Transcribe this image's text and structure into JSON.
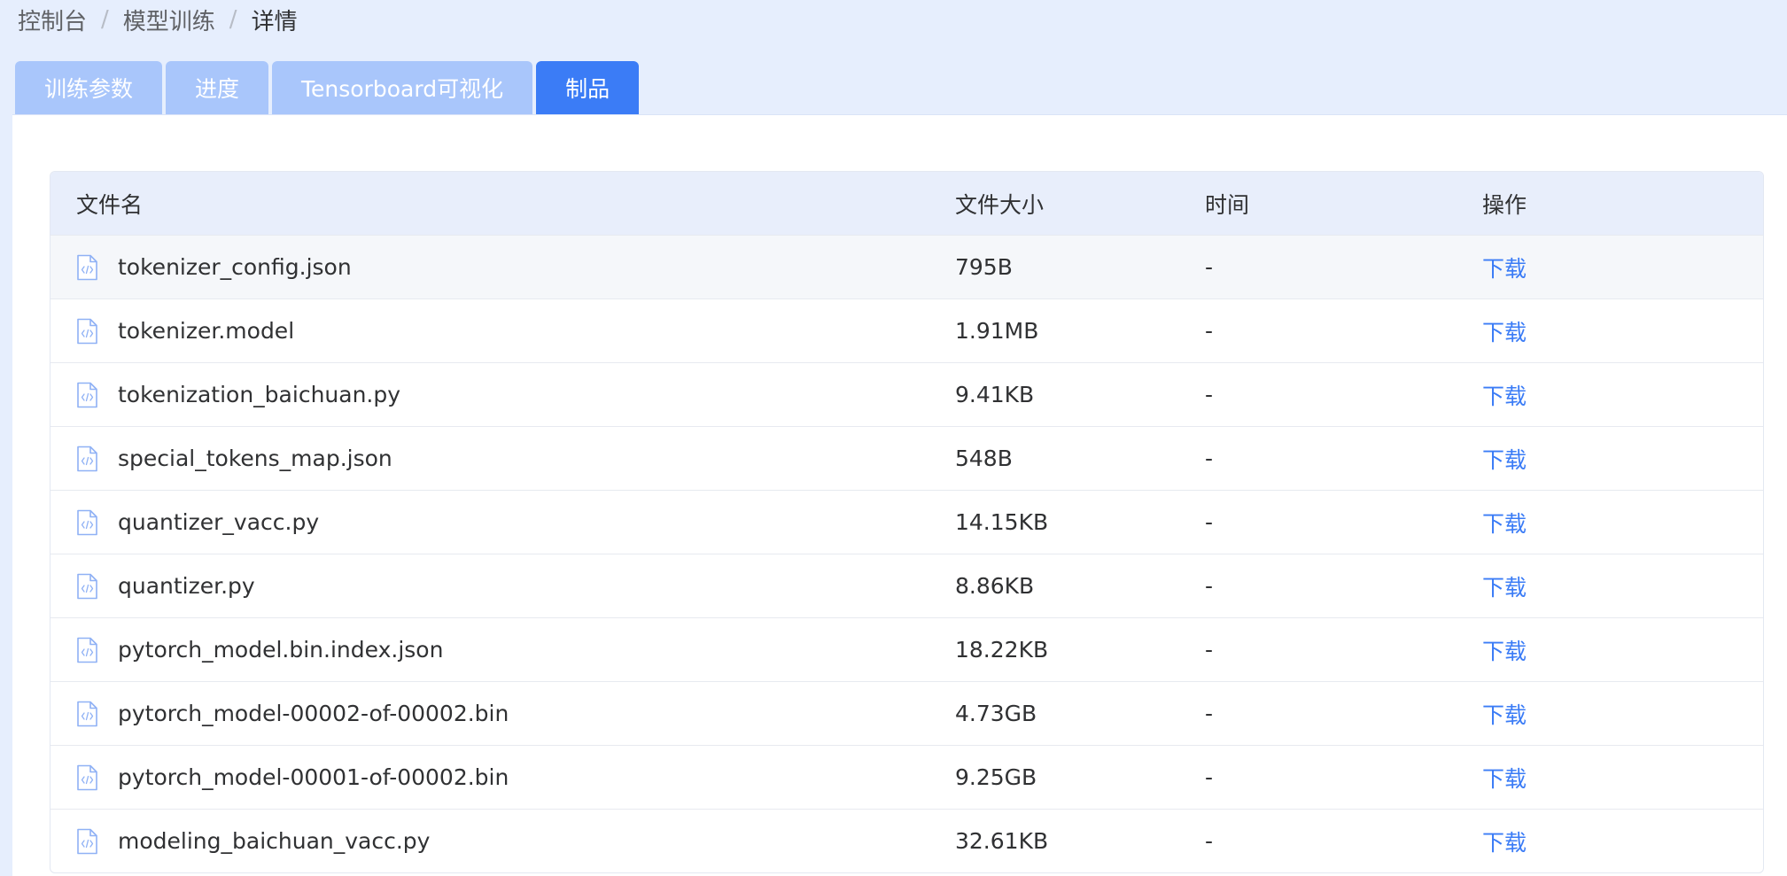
{
  "breadcrumb": {
    "items": [
      "控制台",
      "模型训练",
      "详情"
    ],
    "separator": "/"
  },
  "tabs": [
    "训练参数",
    "进度",
    "Tensorboard可视化",
    "制品"
  ],
  "table": {
    "headers": [
      "文件名",
      "文件大小",
      "时间",
      "操作"
    ],
    "rows": [
      {
        "name": "tokenizer_config.json",
        "size": "795B",
        "time": "-",
        "action": "下载"
      },
      {
        "name": "tokenizer.model",
        "size": "1.91MB",
        "time": "-",
        "action": "下载"
      },
      {
        "name": "tokenization_baichuan.py",
        "size": "9.41KB",
        "time": "-",
        "action": "下载"
      },
      {
        "name": "special_tokens_map.json",
        "size": "548B",
        "time": "-",
        "action": "下载"
      },
      {
        "name": "quantizer_vacc.py",
        "size": "14.15KB",
        "time": "-",
        "action": "下载"
      },
      {
        "name": "quantizer.py",
        "size": "8.86KB",
        "time": "-",
        "action": "下载"
      },
      {
        "name": "pytorch_model.bin.index.json",
        "size": "18.22KB",
        "time": "-",
        "action": "下载"
      },
      {
        "name": "pytorch_model-00002-of-00002.bin",
        "size": "4.73GB",
        "time": "-",
        "action": "下载"
      },
      {
        "name": "pytorch_model-00001-of-00002.bin",
        "size": "9.25GB",
        "time": "-",
        "action": "下载"
      },
      {
        "name": "modeling_baichuan_vacc.py",
        "size": "32.61KB",
        "time": "-",
        "action": "下载"
      }
    ]
  },
  "colors": {
    "accent": "#3b7cf6",
    "tab_inactive": "#a9c6fb",
    "background": "#e6eefd"
  },
  "icons": {
    "file": "file-code-icon"
  }
}
